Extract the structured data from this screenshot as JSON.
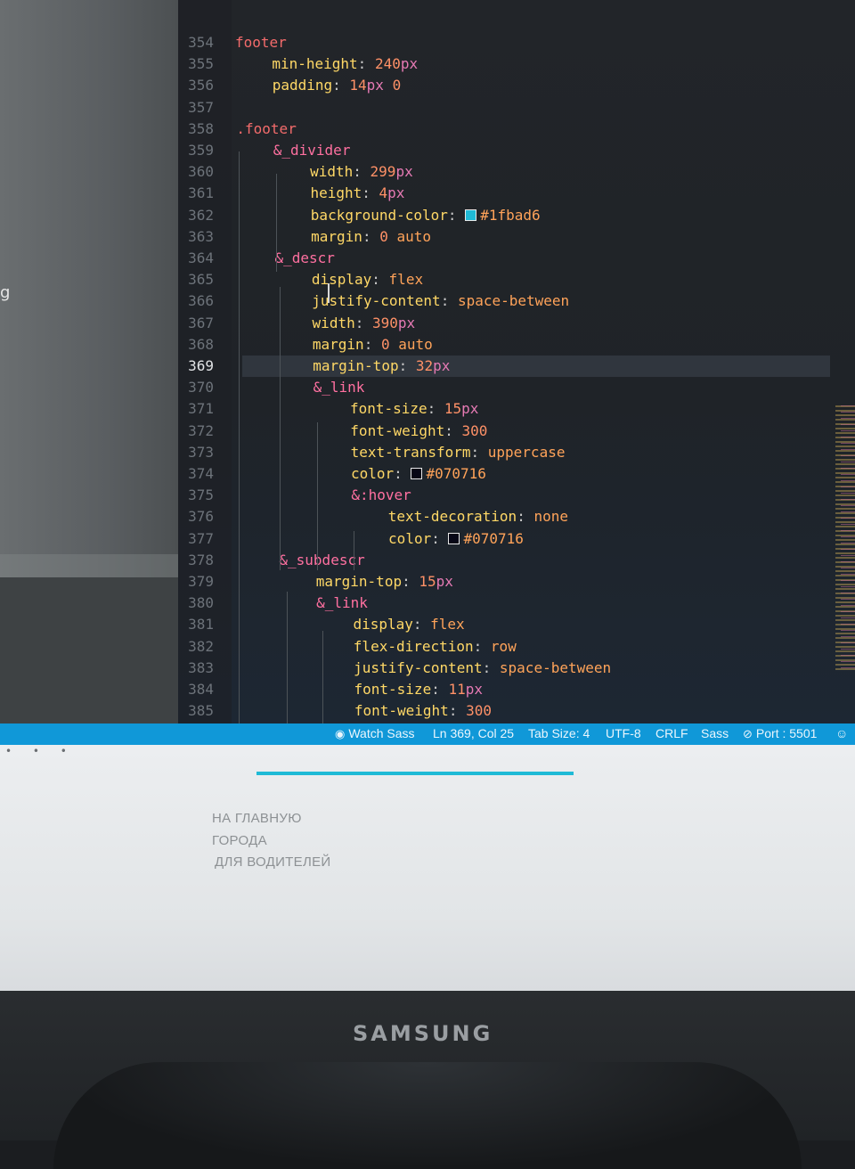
{
  "editor": {
    "lines": [
      {
        "n": "354",
        "indent": 0,
        "parts": [
          [
            "sel",
            "footer"
          ]
        ]
      },
      {
        "n": "355",
        "indent": 1,
        "parts": [
          [
            "prop",
            "min-height"
          ],
          [
            "punc",
            ": "
          ],
          [
            "num",
            "240"
          ],
          [
            "unit",
            "px"
          ]
        ]
      },
      {
        "n": "356",
        "indent": 1,
        "parts": [
          [
            "prop",
            "padding"
          ],
          [
            "punc",
            ": "
          ],
          [
            "num",
            "14"
          ],
          [
            "unit",
            "px"
          ],
          [
            "punc",
            " "
          ],
          [
            "num",
            "0"
          ]
        ]
      },
      {
        "n": "357",
        "indent": 0,
        "parts": []
      },
      {
        "n": "358",
        "indent": 0,
        "parts": [
          [
            "sel",
            ".footer"
          ]
        ]
      },
      {
        "n": "359",
        "indent": 1,
        "parts": [
          [
            "nest",
            "&_divider"
          ]
        ]
      },
      {
        "n": "360",
        "indent": 2,
        "parts": [
          [
            "prop",
            "width"
          ],
          [
            "punc",
            ": "
          ],
          [
            "num",
            "299"
          ],
          [
            "unit",
            "px"
          ]
        ]
      },
      {
        "n": "361",
        "indent": 2,
        "parts": [
          [
            "prop",
            "height"
          ],
          [
            "punc",
            ": "
          ],
          [
            "num",
            "4"
          ],
          [
            "unit",
            "px"
          ]
        ]
      },
      {
        "n": "362",
        "indent": 2,
        "parts": [
          [
            "prop",
            "background-color"
          ],
          [
            "punc",
            ": "
          ],
          [
            "swatch",
            "#1fbad6"
          ],
          [
            "kw",
            "#1fbad6"
          ]
        ]
      },
      {
        "n": "363",
        "indent": 2,
        "parts": [
          [
            "prop",
            "margin"
          ],
          [
            "punc",
            ": "
          ],
          [
            "num",
            "0"
          ],
          [
            "punc",
            " "
          ],
          [
            "kw",
            "auto"
          ]
        ]
      },
      {
        "n": "364",
        "indent": 1,
        "parts": [
          [
            "nest",
            "&_descr"
          ]
        ]
      },
      {
        "n": "365",
        "indent": 2,
        "parts": [
          [
            "prop",
            "display"
          ],
          [
            "punc",
            ": "
          ],
          [
            "kw",
            "flex"
          ]
        ]
      },
      {
        "n": "366",
        "indent": 2,
        "parts": [
          [
            "prop",
            "justify-content"
          ],
          [
            "punc",
            ": "
          ],
          [
            "kw",
            "space-between"
          ]
        ]
      },
      {
        "n": "367",
        "indent": 2,
        "parts": [
          [
            "prop",
            "width"
          ],
          [
            "punc",
            ": "
          ],
          [
            "num",
            "390"
          ],
          [
            "unit",
            "px"
          ]
        ]
      },
      {
        "n": "368",
        "indent": 2,
        "parts": [
          [
            "prop",
            "margin"
          ],
          [
            "punc",
            ": "
          ],
          [
            "num",
            "0"
          ],
          [
            "punc",
            " "
          ],
          [
            "kw",
            "auto"
          ]
        ]
      },
      {
        "n": "369",
        "indent": 2,
        "parts": [
          [
            "prop",
            "margin-top"
          ],
          [
            "punc",
            ": "
          ],
          [
            "num",
            "32"
          ],
          [
            "unit",
            "px"
          ]
        ],
        "current": true
      },
      {
        "n": "370",
        "indent": 2,
        "parts": [
          [
            "nest",
            "&_link"
          ]
        ]
      },
      {
        "n": "371",
        "indent": 3,
        "parts": [
          [
            "prop",
            "font-size"
          ],
          [
            "punc",
            ": "
          ],
          [
            "num",
            "15"
          ],
          [
            "unit",
            "px"
          ]
        ]
      },
      {
        "n": "372",
        "indent": 3,
        "parts": [
          [
            "prop",
            "font-weight"
          ],
          [
            "punc",
            ": "
          ],
          [
            "num",
            "300"
          ]
        ]
      },
      {
        "n": "373",
        "indent": 3,
        "parts": [
          [
            "prop",
            "text-transform"
          ],
          [
            "punc",
            ": "
          ],
          [
            "kw",
            "uppercase"
          ]
        ]
      },
      {
        "n": "374",
        "indent": 3,
        "parts": [
          [
            "prop",
            "color"
          ],
          [
            "punc",
            ": "
          ],
          [
            "swatch",
            "#070716"
          ],
          [
            "kw",
            "#070716"
          ]
        ]
      },
      {
        "n": "375",
        "indent": 3,
        "parts": [
          [
            "nest",
            "&:hover"
          ]
        ]
      },
      {
        "n": "376",
        "indent": 4,
        "parts": [
          [
            "prop",
            "text-decoration"
          ],
          [
            "punc",
            ": "
          ],
          [
            "kw",
            "none"
          ]
        ]
      },
      {
        "n": "377",
        "indent": 4,
        "parts": [
          [
            "prop",
            "color"
          ],
          [
            "punc",
            ": "
          ],
          [
            "swatch",
            "#070716"
          ],
          [
            "kw",
            "#070716"
          ]
        ]
      },
      {
        "n": "378",
        "indent": 1,
        "parts": [
          [
            "nest",
            "&_subdescr"
          ]
        ]
      },
      {
        "n": "379",
        "indent": 2,
        "parts": [
          [
            "prop",
            "margin-top"
          ],
          [
            "punc",
            ": "
          ],
          [
            "num",
            "15"
          ],
          [
            "unit",
            "px"
          ]
        ]
      },
      {
        "n": "380",
        "indent": 2,
        "parts": [
          [
            "nest",
            "&_link"
          ]
        ]
      },
      {
        "n": "381",
        "indent": 3,
        "parts": [
          [
            "prop",
            "display"
          ],
          [
            "punc",
            ": "
          ],
          [
            "kw",
            "flex"
          ]
        ]
      },
      {
        "n": "382",
        "indent": 3,
        "parts": [
          [
            "prop",
            "flex-direction"
          ],
          [
            "punc",
            ": "
          ],
          [
            "kw",
            "row"
          ]
        ]
      },
      {
        "n": "383",
        "indent": 3,
        "parts": [
          [
            "prop",
            "justify-content"
          ],
          [
            "punc",
            ": "
          ],
          [
            "kw",
            "space-between"
          ]
        ]
      },
      {
        "n": "384",
        "indent": 3,
        "parts": [
          [
            "prop",
            "font-size"
          ],
          [
            "punc",
            ": "
          ],
          [
            "num",
            "11"
          ],
          [
            "unit",
            "px"
          ]
        ]
      },
      {
        "n": "385",
        "indent": 3,
        "parts": [
          [
            "prop",
            "font-weight"
          ],
          [
            "punc",
            ": "
          ],
          [
            "num",
            "300"
          ]
        ]
      }
    ]
  },
  "status_bar": {
    "watch_sass": "Watch Sass",
    "cursor_position": "Ln 369, Col 25",
    "tab_size": "Tab Size: 4",
    "encoding": "UTF-8",
    "line_ending": "CRLF",
    "language": "Sass",
    "live_server": "Port : 5501"
  },
  "browser": {
    "footer_links": [
      "НА ГЛАВНУЮ",
      "ГОРОДА",
      "ДЛЯ ВОДИТЕЛЕЙ"
    ],
    "divider_color": "#1fbad6"
  },
  "monitor": {
    "brand": "SAMSUNG"
  },
  "left_panel": {
    "partial_text": "g"
  }
}
